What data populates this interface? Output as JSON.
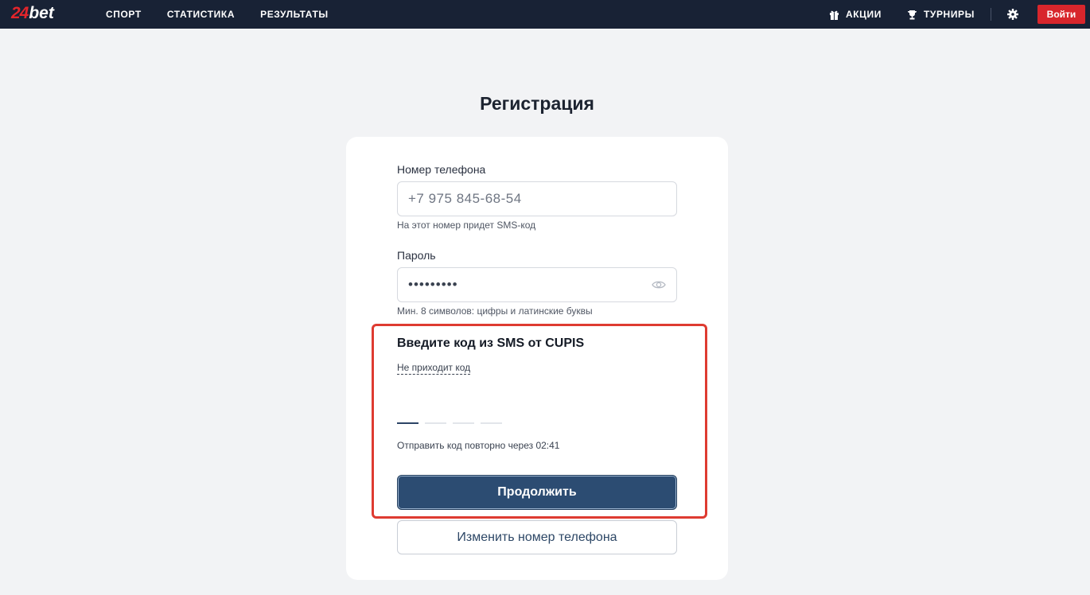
{
  "header": {
    "logo": {
      "number": "24",
      "word": "bet"
    },
    "nav": [
      {
        "label": "СПОРТ"
      },
      {
        "label": "СТАТИСТИКА"
      },
      {
        "label": "РЕЗУЛЬТАТЫ"
      }
    ],
    "promo_label": "АКЦИИ",
    "tournaments_label": "ТУРНИРЫ",
    "login_label": "Войти"
  },
  "page": {
    "title": "Регистрация"
  },
  "form": {
    "phone_label": "Номер телефона",
    "phone_value": "+7 975 845-68-54",
    "phone_hint": "На этот номер придет SMS-код",
    "password_label": "Пароль",
    "password_value": "•••••••••",
    "password_hint": "Мин. 8 символов: цифры и латинские буквы",
    "sms_title": "Введите код из SMS от CUPIS",
    "no_code_link": "Не приходит код",
    "resend_text": "Отправить код повторно через 02:41",
    "continue_label": "Продолжить",
    "change_phone_label": "Изменить номер телефона"
  },
  "colors": {
    "header_bg": "#182235",
    "accent_red": "#d8262c",
    "primary_button": "#2c4c72",
    "highlight_box": "#de3b31",
    "page_bg": "#f2f3f5"
  }
}
